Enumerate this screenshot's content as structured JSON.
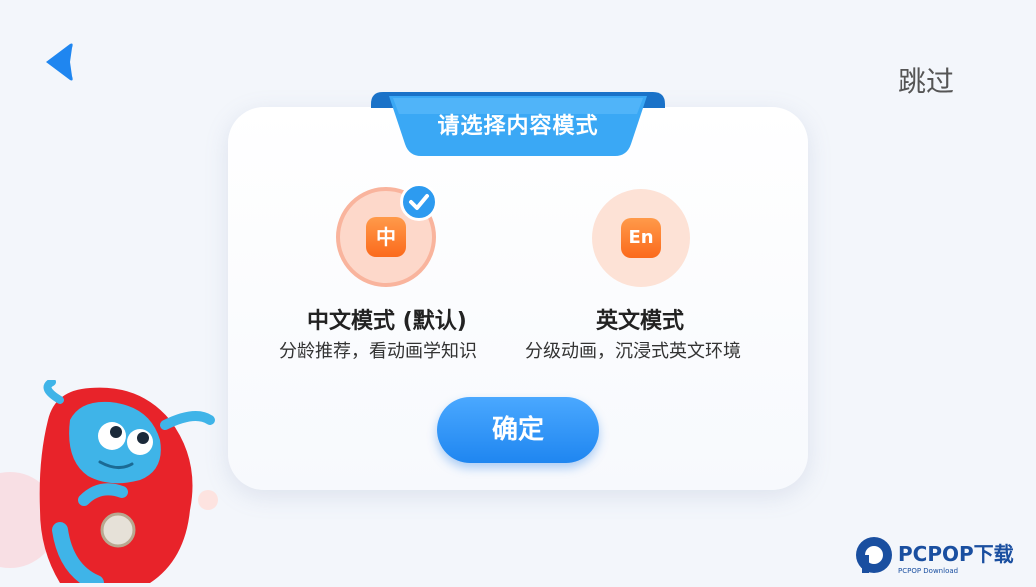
{
  "header": {
    "back_icon": "back-arrow-icon",
    "skip_label": "跳过"
  },
  "dialog": {
    "title": "请选择内容模式",
    "options": [
      {
        "badge": "中",
        "title": "中文模式 (默认)",
        "description": "分龄推荐，看动画学知识",
        "selected": true
      },
      {
        "badge": "En",
        "title": "英文模式",
        "description": "分级动画，沉浸式英文环境",
        "selected": false
      }
    ],
    "confirm_label": "确定"
  },
  "watermark": {
    "brand": "PCPOP下载",
    "subtext": "PCPOP Download"
  },
  "colors": {
    "accent_blue": "#2d9bf0",
    "badge_orange": "#fb6a1c",
    "option_bg": "#fde2d6"
  }
}
